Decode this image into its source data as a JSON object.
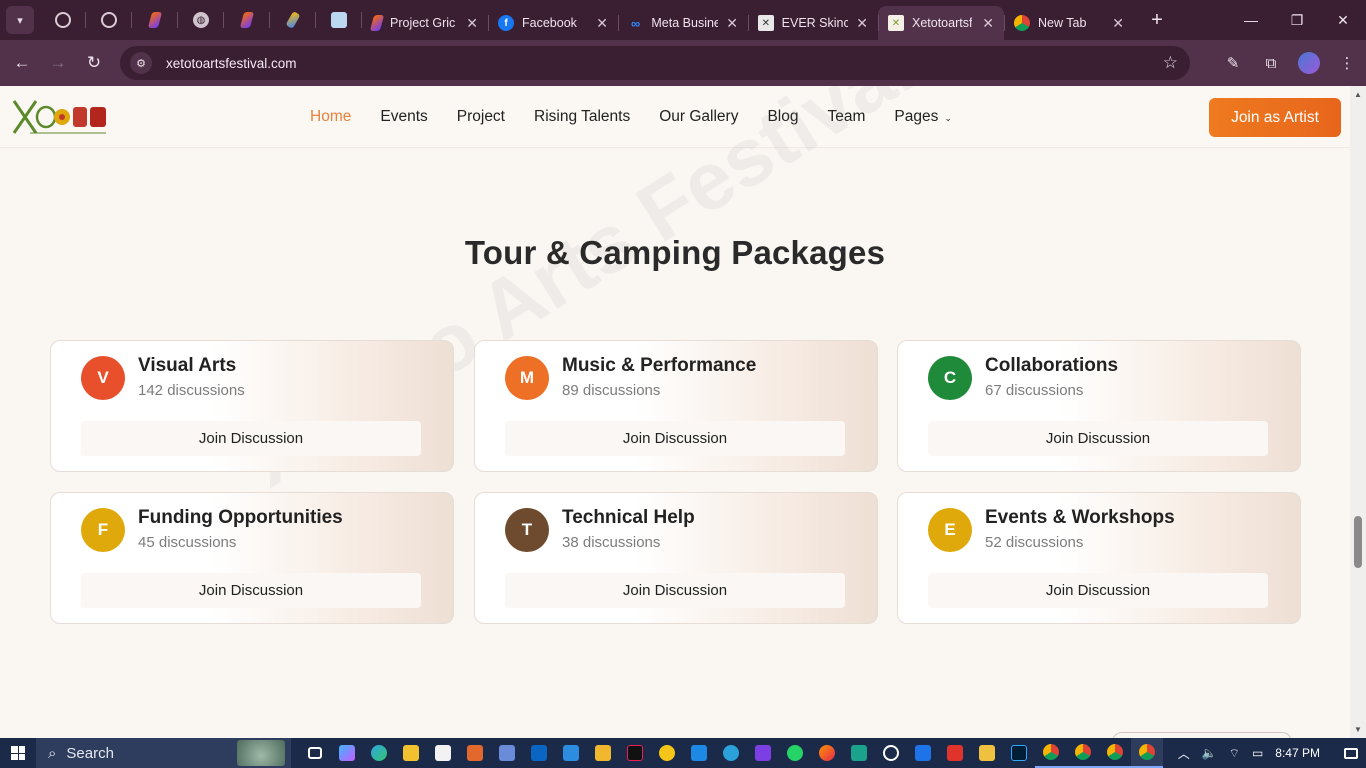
{
  "browser": {
    "tabs": [
      {
        "title": "Project Gric",
        "icon": "slash-logo-icon"
      },
      {
        "title": "Facebook",
        "icon": "facebook-icon"
      },
      {
        "title": "Meta Busine",
        "icon": "meta-icon"
      },
      {
        "title": "EVER Skinc",
        "icon": "x-box-icon"
      },
      {
        "title": "Xetotoartsf",
        "icon": "xetoto-icon",
        "active": true
      },
      {
        "title": "New Tab",
        "icon": "chrome-icon"
      }
    ],
    "new_tab_label": "+",
    "url": "xetotoartsfestival.com"
  },
  "site": {
    "nav": [
      {
        "label": "Home",
        "active": true
      },
      {
        "label": "Events"
      },
      {
        "label": "Project"
      },
      {
        "label": "Rising Talents"
      },
      {
        "label": "Our Gallery"
      },
      {
        "label": "Blog"
      },
      {
        "label": "Team"
      },
      {
        "label": "Pages",
        "dropdown": true
      }
    ],
    "cta_label": "Join as Artist",
    "section_title": "Tour & Camping Packages",
    "watermark": "Xetoto Arts Festival",
    "categories": [
      {
        "initial": "V",
        "title": "Visual Arts",
        "count": "142 discussions",
        "color": "#e8502c",
        "button": "Join Discussion"
      },
      {
        "initial": "M",
        "title": "Music & Performance",
        "count": "89 discussions",
        "color": "#ee6f26",
        "button": "Join Discussion"
      },
      {
        "initial": "C",
        "title": "Collaborations",
        "count": "67 discussions",
        "color": "#1f8a3a",
        "button": "Join Discussion"
      },
      {
        "initial": "F",
        "title": "Funding Opportunities",
        "count": "45 discussions",
        "color": "#e0a90b",
        "button": "Join Discussion"
      },
      {
        "initial": "T",
        "title": "Technical Help",
        "count": "38 discussions",
        "color": "#6e4a2e",
        "button": "Join Discussion"
      },
      {
        "initial": "E",
        "title": "Events & Workshops",
        "count": "52 discussions",
        "color": "#e0a90b",
        "button": "Join Discussion"
      }
    ]
  },
  "colors": {
    "accent": "#e8813b",
    "chrome_dark": "#3a1f33",
    "chrome_mid": "#51324a"
  },
  "taskbar": {
    "search_label": "Search",
    "time": "8:47 PM"
  }
}
